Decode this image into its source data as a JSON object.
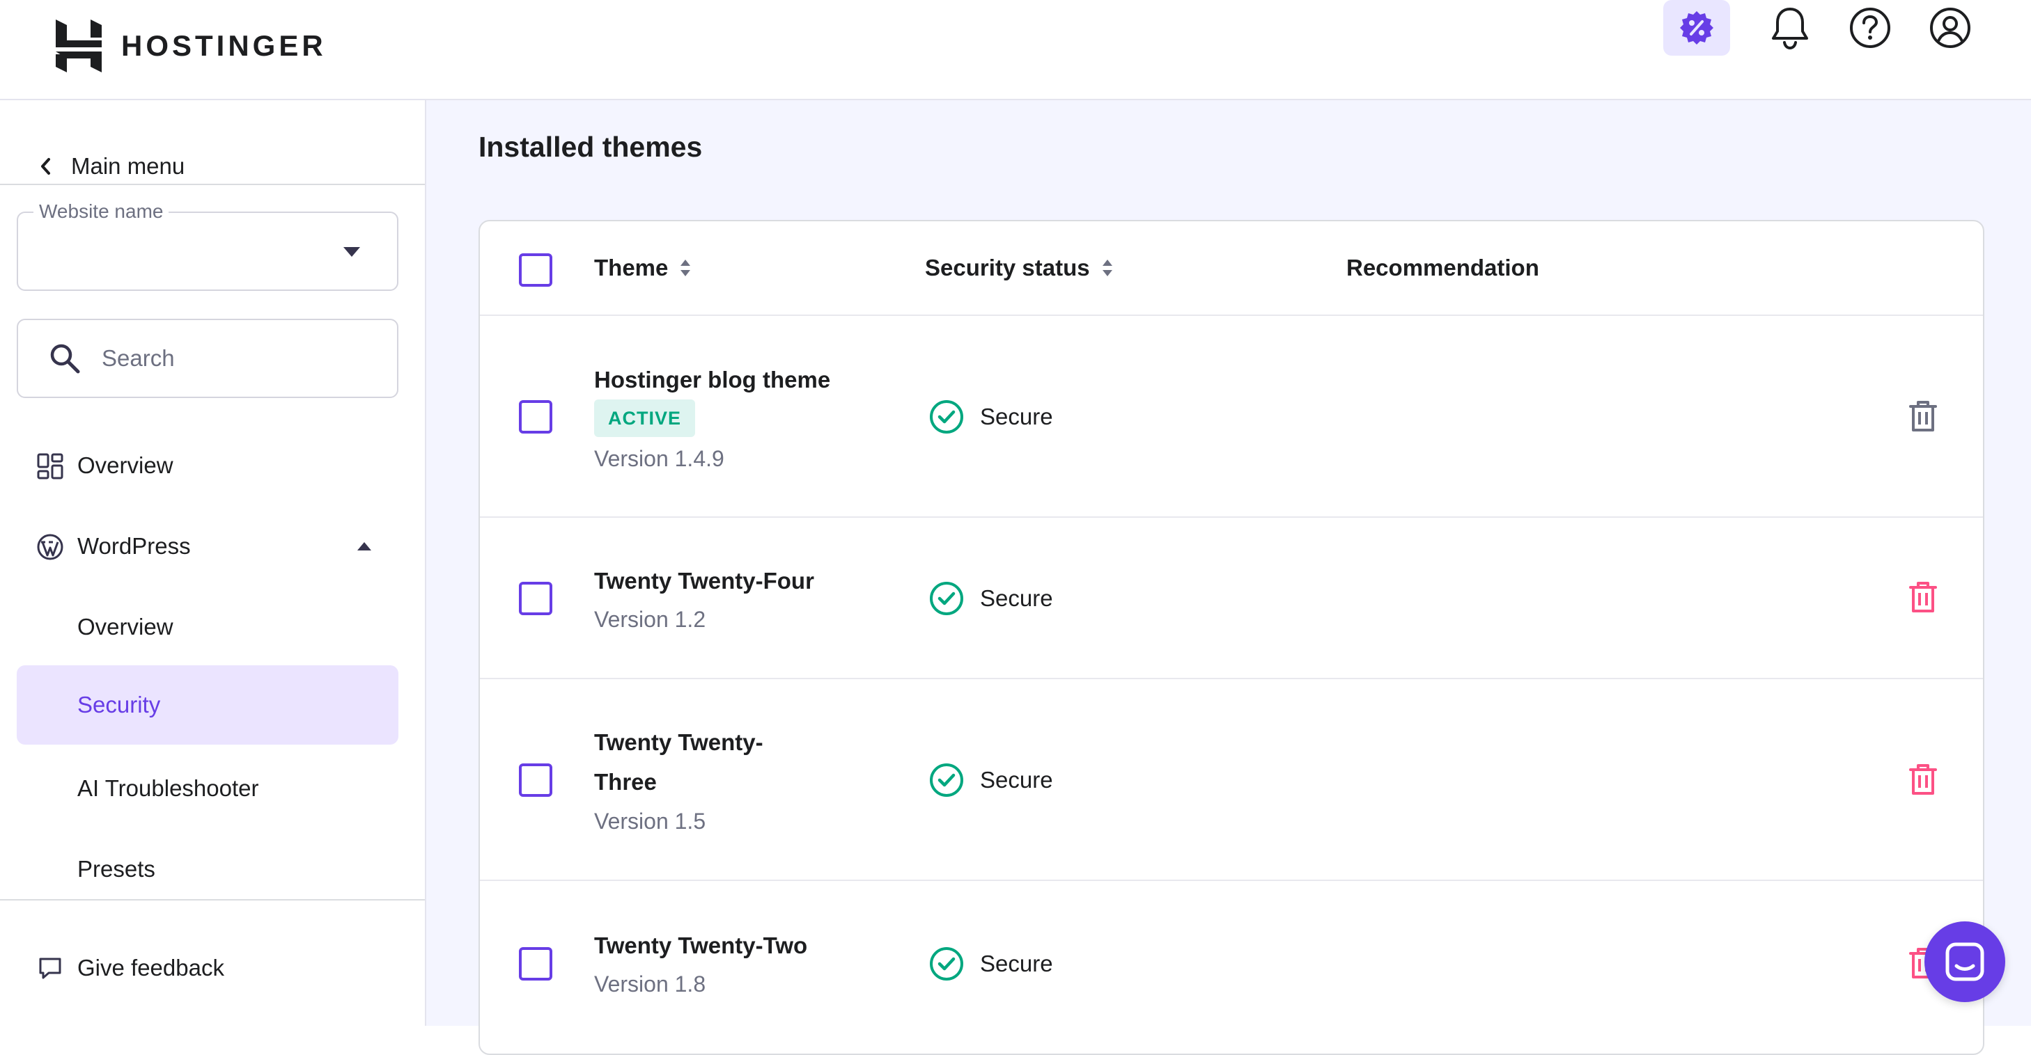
{
  "brand": {
    "name": "HOSTINGER"
  },
  "topbar": {
    "icons": [
      "discount-badge-icon",
      "bell-icon",
      "help-icon",
      "account-icon"
    ]
  },
  "sidebar": {
    "main_menu_label": "Main menu",
    "website_field": {
      "label": "Website name",
      "value": ""
    },
    "search": {
      "placeholder": "Search"
    },
    "items": [
      {
        "label": "Overview",
        "icon": "dashboard-icon"
      },
      {
        "label": "WordPress",
        "icon": "wordpress-icon",
        "expanded": true
      },
      {
        "label": "Overview"
      },
      {
        "label": "Security",
        "active": true
      },
      {
        "label": "AI Troubleshooter"
      },
      {
        "label": "Presets"
      }
    ],
    "feedback_label": "Give feedback"
  },
  "main": {
    "title": "Installed themes",
    "columns": {
      "theme": "Theme",
      "security_status": "Security status",
      "recommendation": "Recommendation"
    },
    "rows": [
      {
        "name": "Hostinger blog theme",
        "badge": "ACTIVE",
        "version": "Version 1.4.9",
        "status": "Secure",
        "delete_enabled": false
      },
      {
        "name": "Twenty Twenty-Four",
        "version": "Version 1.2",
        "status": "Secure",
        "delete_enabled": true
      },
      {
        "name_line1": "Twenty Twenty-",
        "name_line2": "Three",
        "version": "Version 1.5",
        "status": "Secure",
        "delete_enabled": true
      },
      {
        "name": "Twenty Twenty-Two",
        "version": "Version 1.8",
        "status": "Secure",
        "delete_enabled": true
      }
    ]
  },
  "colors": {
    "accent": "#673de6",
    "accent_light": "#ebe4ff",
    "success": "#00a77f",
    "danger": "#fc5185",
    "muted": "#6d7081",
    "page_bg": "#f4f5ff"
  }
}
